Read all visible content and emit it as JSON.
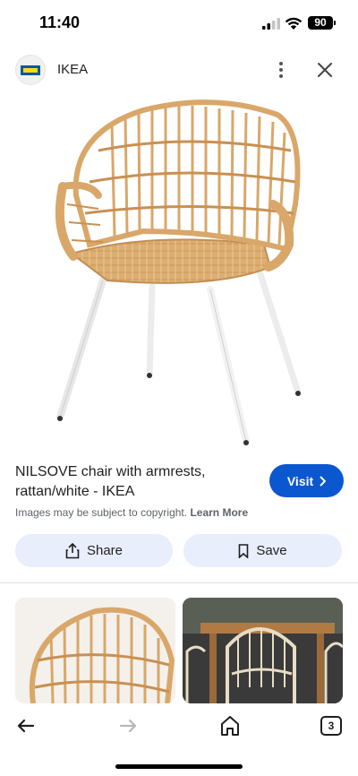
{
  "status_bar": {
    "time": "11:40",
    "battery": "90"
  },
  "header": {
    "site_name": "IKEA"
  },
  "product": {
    "title": "NILSOVE chair with armrests, rattan/white - IKEA",
    "copyright_text": "Images may be subject to copyright.",
    "learn_more": "Learn More",
    "visit_label": "Visit"
  },
  "actions": {
    "share_label": "Share",
    "save_label": "Save"
  },
  "bottom_nav": {
    "tab_count": "3"
  },
  "colors": {
    "accent": "#0b57d0",
    "action_bg": "#e8eefb",
    "rattan": "#d9ab6e"
  }
}
